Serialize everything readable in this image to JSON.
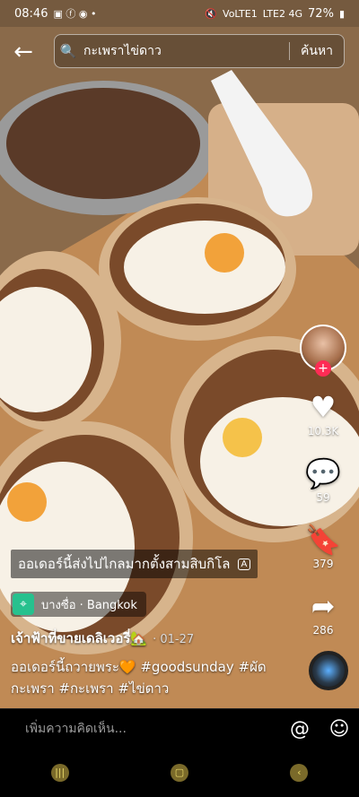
{
  "status": {
    "time": "08:46",
    "battery": "72%",
    "net1": "VoLTE1",
    "net2": "LTE2 4G"
  },
  "search": {
    "value": "กะเพราไข่ดาว",
    "button": "ค้นหา"
  },
  "rail": {
    "likes": "10.3K",
    "comments": "59",
    "saves": "379",
    "shares": "286"
  },
  "post": {
    "caption_overlay": "ออเดอร์นี้ส่งไปไกลมากตั้งสามสิบกิโล",
    "location": "บางซื่อ · Bangkok",
    "author": "เจ้าฟ้าที่ขายเดลิเวอรี่🏡",
    "date": "· 01-27",
    "description": "ออเดอร์นี้ถวายพระ🧡 #goodsunday #ผัดกะเพรา #กะเพรา #ไข่ดาว"
  },
  "comment": {
    "placeholder": "เพิ่มความคิดเห็น..."
  },
  "colors": {
    "like_red": "#fe2c55",
    "location_green": "#27c18e"
  }
}
